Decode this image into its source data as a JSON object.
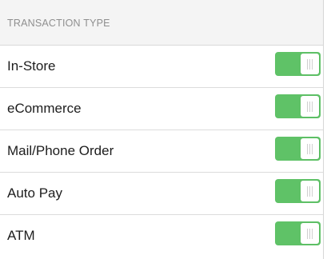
{
  "section": {
    "header": "TRANSACTION TYPE"
  },
  "rows": [
    {
      "label": "In-Store",
      "enabled": true
    },
    {
      "label": "eCommerce",
      "enabled": true
    },
    {
      "label": "Mail/Phone Order",
      "enabled": true
    },
    {
      "label": "Auto Pay",
      "enabled": true
    },
    {
      "label": "ATM",
      "enabled": true
    }
  ],
  "colors": {
    "toggle_on": "#5fc267",
    "header_bg": "#f4f4f4",
    "header_text": "#8f8f8f",
    "row_text": "#1d1d1d"
  }
}
